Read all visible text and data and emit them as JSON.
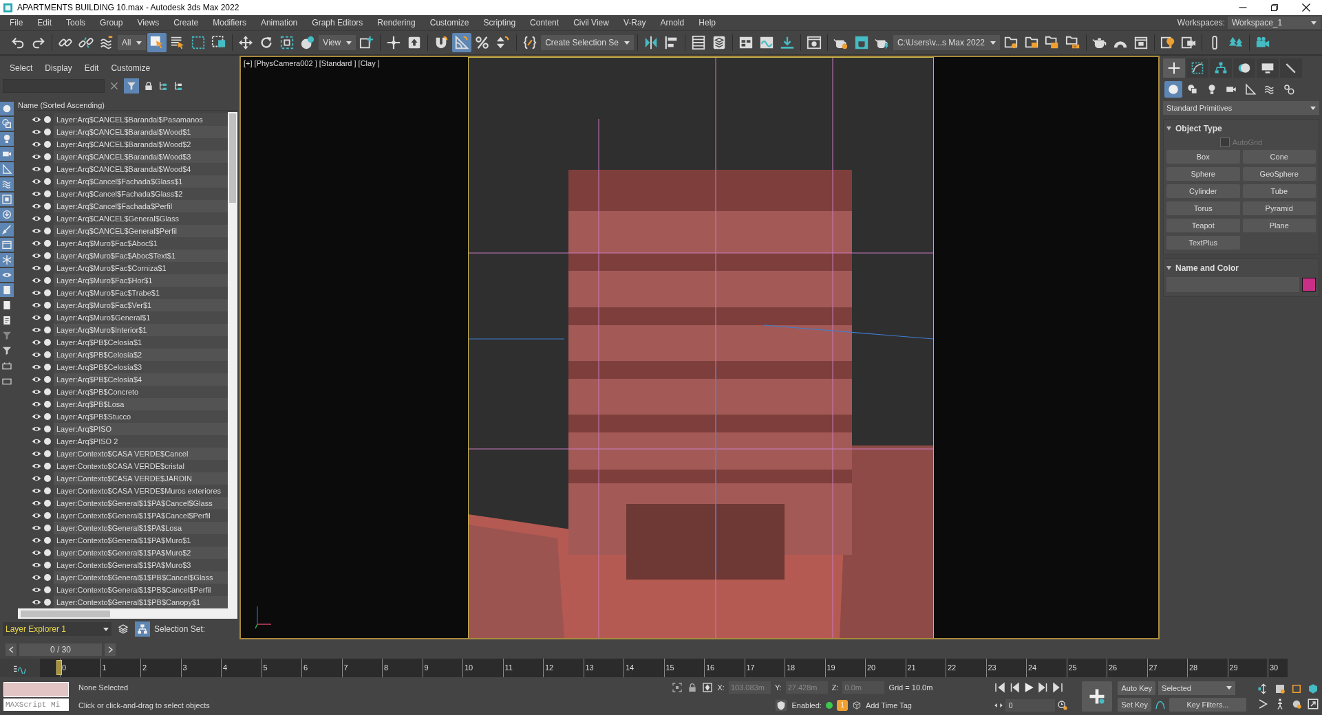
{
  "window": {
    "title": "APARTMENTS BUILDING 10.max - Autodesk 3ds Max 2022"
  },
  "menu": [
    "File",
    "Edit",
    "Tools",
    "Group",
    "Views",
    "Create",
    "Modifiers",
    "Animation",
    "Graph Editors",
    "Rendering",
    "Customize",
    "Scripting",
    "Content",
    "Civil View",
    "V-Ray",
    "Arnold",
    "Help"
  ],
  "workspace": {
    "label": "Workspaces:",
    "value": "Workspace_1"
  },
  "toolbar": [
    {
      "kind": "button",
      "selected": false
    },
    {
      "kind": "button",
      "selected": false
    },
    {
      "kind": "separator"
    },
    {
      "kind": "button",
      "selected": false
    },
    {
      "kind": "button",
      "selected": false
    },
    {
      "kind": "button",
      "selected": false
    },
    {
      "kind": "dropdown",
      "value": "All"
    },
    {
      "kind": "button",
      "selected": true
    },
    {
      "kind": "button",
      "selected": false
    },
    {
      "kind": "button",
      "selected": false
    },
    {
      "kind": "button",
      "selected": false
    },
    {
      "kind": "separator"
    },
    {
      "kind": "button",
      "selected": false
    },
    {
      "kind": "button",
      "selected": false
    },
    {
      "kind": "button",
      "selected": false
    },
    {
      "kind": "button",
      "selected": false
    },
    {
      "kind": "dropdown",
      "value": "View"
    },
    {
      "kind": "button",
      "selected": false
    },
    {
      "kind": "separator"
    },
    {
      "kind": "button",
      "selected": false
    },
    {
      "kind": "button",
      "selected": false
    },
    {
      "kind": "separator"
    },
    {
      "kind": "button",
      "selected": false
    },
    {
      "kind": "button",
      "selected": true
    },
    {
      "kind": "button",
      "selected": false
    },
    {
      "kind": "button",
      "selected": false
    },
    {
      "kind": "separator"
    },
    {
      "kind": "button",
      "selected": false
    },
    {
      "kind": "dropdown",
      "value": "Create Selection Se"
    },
    {
      "kind": "separator"
    },
    {
      "kind": "button",
      "selected": false
    },
    {
      "kind": "button",
      "selected": false
    },
    {
      "kind": "separator"
    },
    {
      "kind": "button",
      "selected": false
    },
    {
      "kind": "button",
      "selected": false
    },
    {
      "kind": "separator"
    },
    {
      "kind": "button",
      "selected": false
    },
    {
      "kind": "button",
      "selected": false
    },
    {
      "kind": "button",
      "selected": false
    },
    {
      "kind": "separator"
    },
    {
      "kind": "button",
      "selected": false
    },
    {
      "kind": "separator"
    },
    {
      "kind": "button",
      "selected": false
    },
    {
      "kind": "button",
      "selected": false
    },
    {
      "kind": "button",
      "selected": false
    },
    {
      "kind": "dropdown",
      "value": "C:\\Users\\v...s Max 2022"
    },
    {
      "kind": "button",
      "selected": false
    },
    {
      "kind": "button",
      "selected": false
    },
    {
      "kind": "button",
      "selected": false
    },
    {
      "kind": "button",
      "selected": false
    },
    {
      "kind": "separator"
    },
    {
      "kind": "button",
      "selected": false
    },
    {
      "kind": "button",
      "selected": false
    },
    {
      "kind": "button",
      "selected": false
    },
    {
      "kind": "separator"
    },
    {
      "kind": "button",
      "selected": false
    },
    {
      "kind": "button",
      "selected": false
    },
    {
      "kind": "separator"
    },
    {
      "kind": "button",
      "selected": false
    },
    {
      "kind": "button",
      "selected": false
    },
    {
      "kind": "separator"
    },
    {
      "kind": "button",
      "selected": false
    }
  ],
  "explorer": {
    "menu": [
      "Select",
      "Display",
      "Edit",
      "Customize"
    ],
    "filters": [
      {
        "on": true
      },
      {
        "on": true
      },
      {
        "on": true
      },
      {
        "on": true
      },
      {
        "on": true
      },
      {
        "on": true
      },
      {
        "on": true
      },
      {
        "on": true
      },
      {
        "on": true
      },
      {
        "on": true
      },
      {
        "on": true
      },
      {
        "on": true
      },
      {
        "on": true
      },
      {
        "on": false
      },
      {
        "on": false
      },
      {
        "on": false
      },
      {
        "on": false
      },
      {
        "on": false
      },
      {
        "on": false
      }
    ],
    "column": "Name (Sorted Ascending)",
    "layers": [
      {
        "name": "Layer:Arq$CANCEL$Barandal$Pasamanos"
      },
      {
        "name": "Layer:Arq$CANCEL$Barandal$Wood$1"
      },
      {
        "name": "Layer:Arq$CANCEL$Barandal$Wood$2"
      },
      {
        "name": "Layer:Arq$CANCEL$Barandal$Wood$3"
      },
      {
        "name": "Layer:Arq$CANCEL$Barandal$Wood$4"
      },
      {
        "name": "Layer:Arq$Cancel$Fachada$Glass$1"
      },
      {
        "name": "Layer:Arq$Cancel$Fachada$Glass$2"
      },
      {
        "name": "Layer:Arq$Cancel$Fachada$Perfil"
      },
      {
        "name": "Layer:Arq$CANCEL$General$Glass"
      },
      {
        "name": "Layer:Arq$CANCEL$General$Perfil"
      },
      {
        "name": "Layer:Arq$Muro$Fac$Aboc$1"
      },
      {
        "name": "Layer:Arq$Muro$Fac$Aboc$Text$1"
      },
      {
        "name": "Layer:Arq$Muro$Fac$Corniza$1"
      },
      {
        "name": "Layer:Arq$Muro$Fac$Hor$1"
      },
      {
        "name": "Layer:Arq$Muro$Fac$Trabe$1"
      },
      {
        "name": "Layer:Arq$Muro$Fac$Ver$1"
      },
      {
        "name": "Layer:Arq$Muro$General$1"
      },
      {
        "name": "Layer:Arq$Muro$Interior$1"
      },
      {
        "name": "Layer:Arq$PB$Celosía$1"
      },
      {
        "name": "Layer:Arq$PB$Celosía$2"
      },
      {
        "name": "Layer:Arq$PB$Celosía$3"
      },
      {
        "name": "Layer:Arq$PB$Celosía$4"
      },
      {
        "name": "Layer:Arq$PB$Concreto"
      },
      {
        "name": "Layer:Arq$PB$Losa"
      },
      {
        "name": "Layer:Arq$PB$Stucco"
      },
      {
        "name": "Layer:Arq$PISO"
      },
      {
        "name": "Layer:Arq$PISO 2"
      },
      {
        "name": "Layer:Contexto$CASA VERDE$Cancel"
      },
      {
        "name": "Layer:Contexto$CASA VERDE$cristal"
      },
      {
        "name": "Layer:Contexto$CASA VERDE$JARDIN"
      },
      {
        "name": "Layer:Contexto$CASA VERDE$Muros exteriores"
      },
      {
        "name": "Layer:Contexto$General$1$PA$Cancel$Glass"
      },
      {
        "name": "Layer:Contexto$General$1$PA$Cancel$Perfil"
      },
      {
        "name": "Layer:Contexto$General$1$PA$Losa"
      },
      {
        "name": "Layer:Contexto$General$1$PA$Muro$1"
      },
      {
        "name": "Layer:Contexto$General$1$PA$Muro$2"
      },
      {
        "name": "Layer:Contexto$General$1$PA$Muro$3"
      },
      {
        "name": "Layer:Contexto$General$1$PB$Cancel$Glass"
      },
      {
        "name": "Layer:Contexto$General$1$PB$Cancel$Perfil"
      },
      {
        "name": "Layer:Contexto$General$1$PB$Canopy$1"
      }
    ],
    "explorer_name": "Layer Explorer 1",
    "selection_set": "Selection Set:"
  },
  "viewport": {
    "label": "[+] [PhysCamera002 ] [Standard ] [Clay ]"
  },
  "command_panel": {
    "tabs": [
      {
        "selected": true
      },
      {
        "selected": false
      },
      {
        "selected": false
      },
      {
        "selected": false
      },
      {
        "selected": false
      },
      {
        "selected": false
      }
    ],
    "categories": [
      {
        "selected": true
      },
      {
        "selected": false
      },
      {
        "selected": false
      },
      {
        "selected": false
      },
      {
        "selected": false
      },
      {
        "selected": false
      },
      {
        "selected": false
      }
    ],
    "dropdown": "Standard Primitives",
    "object_type": {
      "title": "Object Type",
      "autogrid": {
        "label": "AutoGrid",
        "checked": false,
        "disabled": true
      },
      "buttons": [
        "Box",
        "Cone",
        "Sphere",
        "GeoSphere",
        "Cylinder",
        "Tube",
        "Torus",
        "Pyramid",
        "Teapot",
        "Plane",
        "TextPlus"
      ]
    },
    "name_and_color": {
      "title": "Name and Color",
      "color": "#c92f86"
    }
  },
  "time_slider": {
    "frame": "0 / 30",
    "ticks": [
      "0",
      "1",
      "2",
      "3",
      "4",
      "5",
      "6",
      "7",
      "8",
      "9",
      "10",
      "11",
      "12",
      "13",
      "14",
      "15",
      "16",
      "17",
      "18",
      "19",
      "20",
      "21",
      "22",
      "23",
      "24",
      "25",
      "26",
      "27",
      "28",
      "29",
      "30"
    ]
  },
  "status": {
    "listener": "MAXScript Mi",
    "selection": "None Selected",
    "prompt": "Click or click-and-drag to select objects",
    "x_label": "X:",
    "x": "103.083m",
    "y_label": "Y:",
    "y": "27.428m",
    "z_label": "Z:",
    "z": "0.0m",
    "grid": "Grid = 10.0m",
    "enabled": "Enabled:",
    "badge": "1",
    "time_tag": "Add Time Tag",
    "frame": "0",
    "auto_key": "Auto Key",
    "key_mode": "Selected",
    "set_key": "Set Key",
    "key_filters": "Key Filters..."
  }
}
